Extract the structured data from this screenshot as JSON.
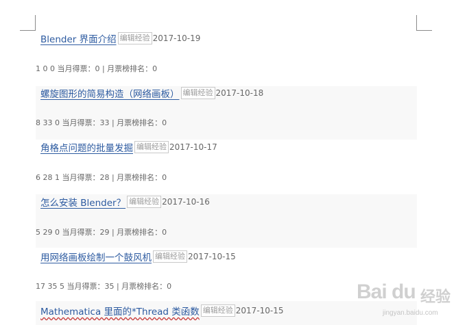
{
  "articles": [
    {
      "title": "Blender 界面介绍",
      "edit": "编辑经验",
      "date": "2017-10-19",
      "stats": "1 0 0 当月得票：0 | 月票榜排名：0"
    },
    {
      "title": "螺旋图形的简易构造（网络画板）",
      "edit": "编辑经验",
      "date": "2017-10-18",
      "stats": "8 33 0 当月得票：33 | 月票榜排名：0"
    },
    {
      "title": "角格点问题的批量发掘",
      "edit": "编辑经验",
      "date": "2017-10-17",
      "stats": "6 28 1 当月得票：28 | 月票榜排名：0"
    },
    {
      "title": "怎么安装 Blender？",
      "edit": "编辑经验",
      "date": "2017-10-16",
      "stats": "5 29 0 当月得票：29 | 月票榜排名：0"
    },
    {
      "title": "用网络画板绘制一个鼓风机",
      "edit": "编辑经验",
      "date": "2017-10-15",
      "stats": "17 35 5 当月得票：35 | 月票榜排名：0"
    },
    {
      "title": "Mathematica 里面的*Thread 类函数",
      "edit": "编辑经验",
      "date": "2017-10-15",
      "stats": ""
    }
  ],
  "watermark": {
    "logo": "Bai du",
    "cn": "经验",
    "url": "jingyan.baidu.com"
  }
}
